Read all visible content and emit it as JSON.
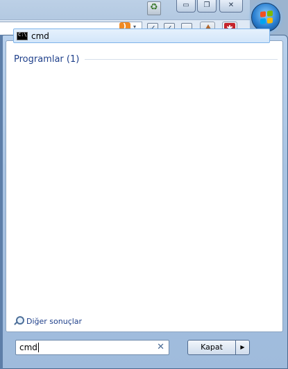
{
  "start_menu": {
    "section_title": "Programlar (1)",
    "results": [
      {
        "label": "cmd",
        "icon": "cmd-icon"
      }
    ],
    "more_results_label": "Diğer sonuçlar",
    "search": {
      "value": "cmd",
      "clear_glyph": "✕"
    },
    "shutdown_label": "Kapat",
    "shutdown_arrow_glyph": "▶"
  },
  "background_window": {
    "caption_min_glyph": "▭",
    "caption_restore_glyph": "❐",
    "caption_close_glyph": "✕",
    "check_glyph": "✓",
    "dropdown_glyph": "▾"
  },
  "colors": {
    "accent_text": "#1e3f8a",
    "selection_border": "#7eb4ea",
    "frame": "#a8c3e2"
  }
}
